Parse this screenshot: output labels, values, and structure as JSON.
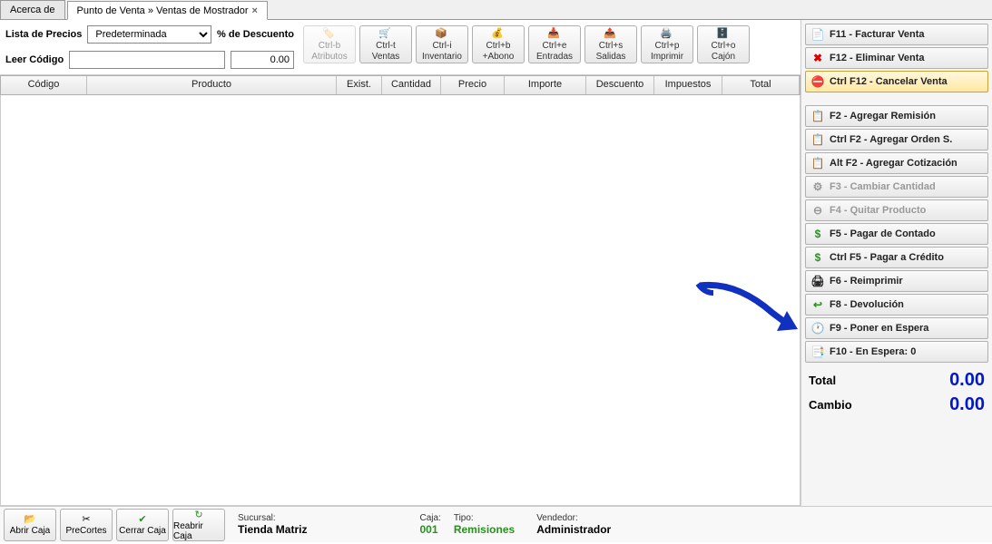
{
  "tabs": {
    "t1": "Acerca de",
    "t2": "Punto de Venta » Ventas de Mostrador"
  },
  "controls": {
    "priceListLabel": "Lista de Precios",
    "priceListValue": "Predeterminada",
    "discountLabel": "% de Descuento",
    "discountValue": "0.00",
    "readCodeLabel": "Leer Código",
    "readCodeValue": ""
  },
  "toolbar": {
    "attrs": {
      "sc": "Ctrl-b",
      "lbl": "Atributos"
    },
    "ventas": {
      "sc": "Ctrl-t",
      "lbl": "Ventas"
    },
    "inv": {
      "sc": "Ctrl-i",
      "lbl": "Inventario"
    },
    "abono": {
      "sc": "Ctrl+b",
      "lbl": "+Abono"
    },
    "entradas": {
      "sc": "Ctrl+e",
      "lbl": "Entradas"
    },
    "salidas": {
      "sc": "Ctrl+s",
      "lbl": "Salidas"
    },
    "imprimir": {
      "sc": "Ctrl+p",
      "lbl": "Imprimir"
    },
    "cajon": {
      "sc": "Ctrl+o",
      "lbl": "Cajón"
    }
  },
  "grid": {
    "codigo": "Código",
    "producto": "Producto",
    "exist": "Exist.",
    "cantidad": "Cantidad",
    "precio": "Precio",
    "importe": "Importe",
    "descuento": "Descuento",
    "impuestos": "Impuestos",
    "total": "Total"
  },
  "side": {
    "f11": "F11 - Facturar Venta",
    "f12": "F12 - Eliminar Venta",
    "cf12": "Ctrl F12 - Cancelar Venta",
    "f2": "F2 - Agregar Remisión",
    "cf2": "Ctrl F2 - Agregar Orden S.",
    "af2": "Alt F2 - Agregar Cotización",
    "f3": "F3 - Cambiar Cantidad",
    "f4": "F4 - Quitar Producto",
    "f5": "F5 - Pagar de Contado",
    "cf5": "Ctrl F5 - Pagar a Crédito",
    "f6": "F6 - Reimprimir",
    "f8": "F8 - Devolución",
    "f9": "F9 - Poner en Espera",
    "f10": "F10 - En Espera: 0"
  },
  "totals": {
    "totalLbl": "Total",
    "totalVal": "0.00",
    "cambioLbl": "Cambio",
    "cambioVal": "0.00"
  },
  "bottom": {
    "abrir": "Abrir Caja",
    "pre": "PreCortes",
    "cerrar": "Cerrar Caja",
    "reabrir": "Reabrir Caja",
    "sucLbl": "Sucursal:",
    "sucVal": "Tienda Matriz",
    "cajaLbl": "Caja:",
    "cajaVal": "001",
    "tipoLbl": "Tipo:",
    "tipoVal": "Remisiones",
    "vendLbl": "Vendedor:",
    "vendVal": "Administrador"
  }
}
